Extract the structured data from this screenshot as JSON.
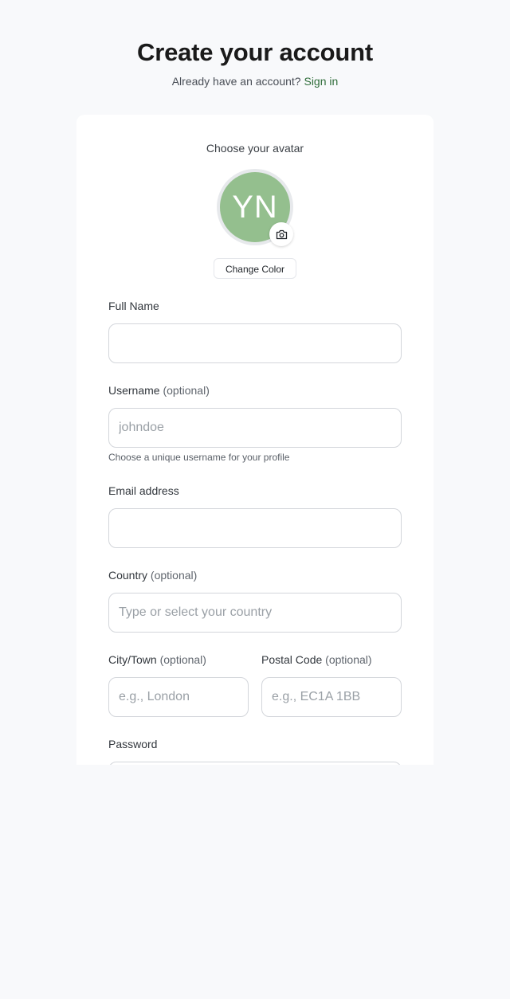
{
  "header": {
    "title": "Create your account",
    "signin_prompt": "Already have an account?",
    "signin_link": "Sign in"
  },
  "avatar": {
    "heading": "Choose your avatar",
    "initials": "YN",
    "color": "#94bf8e",
    "change_color_label": "Change Color",
    "camera_icon": "camera-icon"
  },
  "form": {
    "full_name": {
      "label": "Full Name",
      "value": "",
      "placeholder": ""
    },
    "username": {
      "label": "Username",
      "optional": "(optional)",
      "value": "",
      "placeholder": "johndoe",
      "hint": "Choose a unique username for your profile"
    },
    "email": {
      "label": "Email address",
      "value": "",
      "placeholder": ""
    },
    "country": {
      "label": "Country",
      "optional": "(optional)",
      "value": "",
      "placeholder": "Type or select your country"
    },
    "city": {
      "label": "City/Town",
      "optional": "(optional)",
      "value": "",
      "placeholder": "e.g., London"
    },
    "postal": {
      "label": "Postal Code",
      "optional": "(optional)",
      "value": "",
      "placeholder": "e.g., EC1A 1BB"
    },
    "password": {
      "label": "Password",
      "value": "",
      "placeholder": ""
    }
  },
  "colors": {
    "page_background": "#f8f9fb",
    "link": "#2f6d3a",
    "avatar_background": "#94bf8e"
  }
}
